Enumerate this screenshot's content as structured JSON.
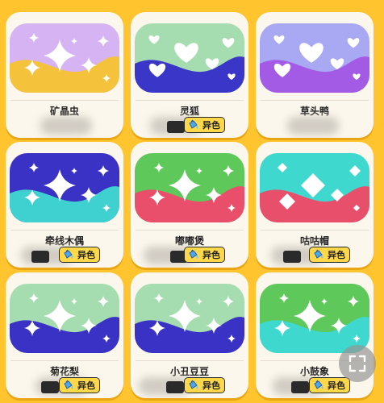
{
  "cards": [
    {
      "name": "矿晶虫",
      "palette": {
        "top": "#D6B3F2",
        "bottom": "#F5C33B"
      },
      "shape": "sparkle",
      "badge": null
    },
    {
      "name": "灵狐",
      "palette": {
        "top": "#A6DDB0",
        "bottom": "#3A36C8"
      },
      "shape": "heart",
      "badge": "异色"
    },
    {
      "name": "草头鸭",
      "palette": {
        "top": "#A9A8F2",
        "bottom": "#A35BE6"
      },
      "shape": "heart",
      "badge": null
    },
    {
      "name": "牵线木偶",
      "palette": {
        "top": "#3A32C4",
        "bottom": "#3ED1CF"
      },
      "shape": "sparkle",
      "badge": "异色"
    },
    {
      "name": "嘟嘟煲",
      "palette": {
        "top": "#5EC85A",
        "bottom": "#E94F6A"
      },
      "shape": "sparkle",
      "badge": "异色"
    },
    {
      "name": "咕咕帽",
      "palette": {
        "top": "#3ED8CE",
        "bottom": "#E84F6A"
      },
      "shape": "diamond",
      "badge": "异色"
    },
    {
      "name": "菊花梨",
      "palette": {
        "top": "#A6DDB0",
        "bottom": "#3A32C4"
      },
      "shape": "sparkle",
      "badge": "异色"
    },
    {
      "name": "小丑豆豆",
      "palette": {
        "top": "#A6DDB0",
        "bottom": "#3A32C4"
      },
      "shape": "sparkle",
      "badge": "异色"
    },
    {
      "name": "小鼓象",
      "palette": {
        "top": "#5EC85A",
        "bottom": "#3ED8CE"
      },
      "shape": "sparkle",
      "badge": "异色"
    }
  ],
  "badge_icon": "paint-bucket-icon",
  "fullscreen_icon": "fullscreen-icon"
}
